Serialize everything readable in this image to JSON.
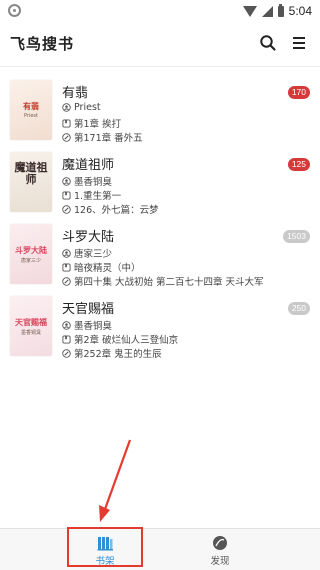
{
  "status_bar": {
    "time": "5:04"
  },
  "header": {
    "title": "飞鸟搜书"
  },
  "books": [
    {
      "title": "有翡",
      "author": "Priest",
      "chapter": "第1章 挨打",
      "latest": "第171章 番外五",
      "unread": "170",
      "badge_color": "#d6393a",
      "cover": {
        "title": "有翡",
        "subtitle": "Priest",
        "bg": "#f4e6dc",
        "title_color": "#c33b2c"
      }
    },
    {
      "title": "魔道祖师",
      "author": "墨香铜臭",
      "chapter": "1.重生第一",
      "latest": "126、外七篇：云梦",
      "unread": "125",
      "badge_color": "#d6393a",
      "cover": {
        "title": "魔道祖师",
        "subtitle": "",
        "bg": "#f2ece4",
        "title_color": "#3a2a2a"
      }
    },
    {
      "title": "斗罗大陆",
      "author": "唐家三少",
      "chapter": "暗夜精灵（中）",
      "latest": "第四十集 大战初始 第二百七十四章 天斗大军",
      "unread": "1503",
      "badge_color": "#c9c9c9",
      "cover": {
        "title": "斗罗大陆",
        "subtitle": "唐家三少",
        "bg": "#f7e7ea",
        "title_color": "#d9435a"
      }
    },
    {
      "title": "天官赐福",
      "author": "墨香铜臭",
      "chapter": "第2章 破烂仙人三登仙京",
      "latest": "第252章 鬼王的生辰",
      "unread": "250",
      "badge_color": "#c9c9c9",
      "cover": {
        "title": "天官赐福",
        "subtitle": "墨香铜臭",
        "bg": "#f8e9ec",
        "title_color": "#d9435a"
      }
    }
  ],
  "bottom_nav": {
    "bookshelf": {
      "label": "书架",
      "color": "#2f8fd8"
    },
    "discover": {
      "label": "发现",
      "color": "#555555"
    }
  },
  "colors": {
    "accent": "#2f8fd8",
    "annotation": "#e53a30"
  }
}
